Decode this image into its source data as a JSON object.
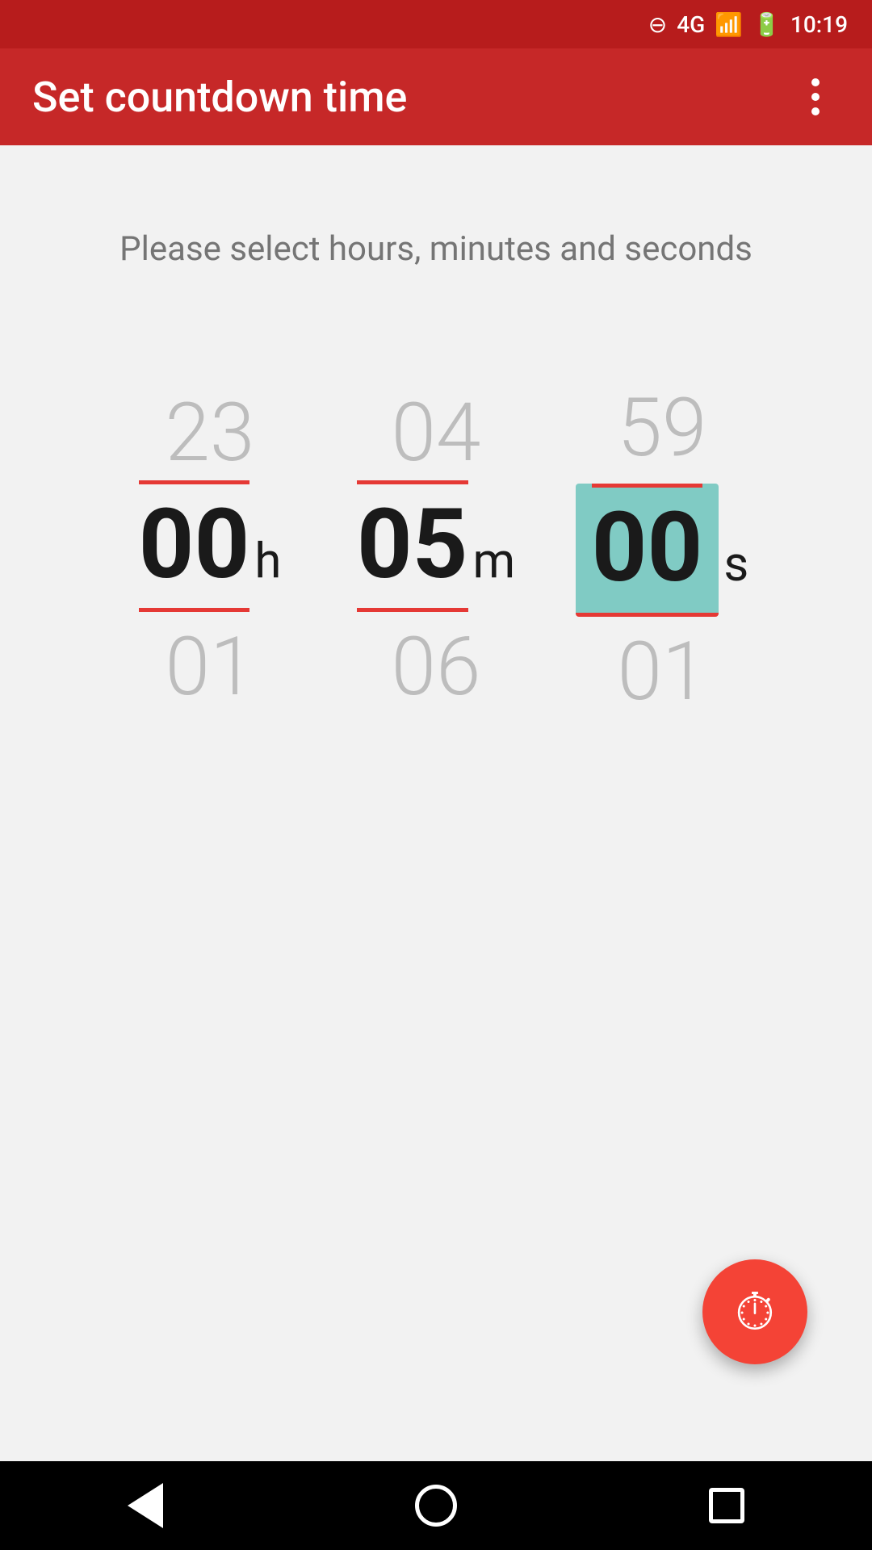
{
  "statusBar": {
    "network": "4G",
    "time": "10:19"
  },
  "header": {
    "title": "Set countdown time",
    "menuIconLabel": "more-options"
  },
  "main": {
    "subtitle": "Please select hours, minutes and seconds",
    "timePicker": {
      "hours": {
        "above": "23",
        "current": "00",
        "label": "h",
        "below": "01",
        "highlighted": false
      },
      "minutes": {
        "above": "04",
        "current": "05",
        "label": "m",
        "below": "06",
        "highlighted": false
      },
      "seconds": {
        "above": "59",
        "current": "00",
        "label": "s",
        "below": "01",
        "highlighted": true
      }
    }
  },
  "fab": {
    "icon": "⏱",
    "label": "Start timer"
  },
  "navBar": {
    "back": "back",
    "home": "home",
    "recents": "recents"
  }
}
